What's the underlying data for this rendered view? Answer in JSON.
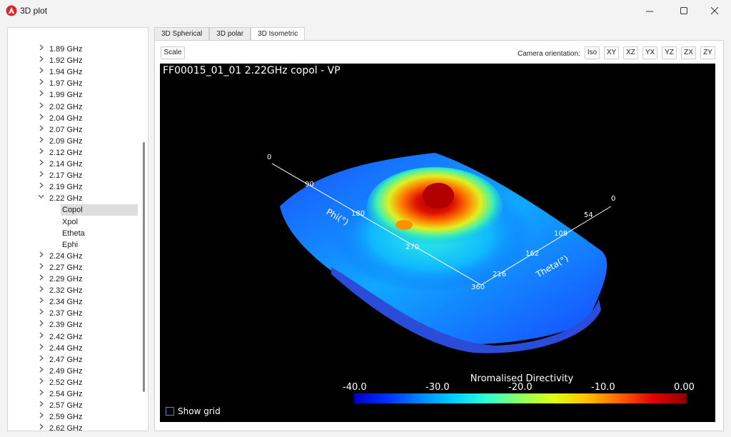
{
  "window": {
    "title": "3D plot"
  },
  "tree": {
    "before": [
      "1.89 GHz",
      "1.92 GHz",
      "1.94 GHz",
      "1.97 GHz",
      "1.99 GHz",
      "2.02 GHz",
      "2.04 GHz",
      "2.07 GHz",
      "2.09 GHz",
      "2.12 GHz",
      "2.14 GHz",
      "2.17 GHz",
      "2.19 GHz"
    ],
    "expanded": "2.22 GHz",
    "children": [
      "Copol",
      "Xpol",
      "Etheta",
      "Ephi"
    ],
    "selected_child": "Copol",
    "after": [
      "2.24 GHz",
      "2.27 GHz",
      "2.29 GHz",
      "2.32 GHz",
      "2.34 GHz",
      "2.37 GHz",
      "2.39 GHz",
      "2.42 GHz",
      "2.44 GHz",
      "2.47 GHz",
      "2.49 GHz",
      "2.52 GHz",
      "2.54 GHz",
      "2.57 GHz",
      "2.59 GHz",
      "2.62 GHz"
    ]
  },
  "tabs": [
    "3D Spherical",
    "3D polar",
    "3D Isometric"
  ],
  "active_tab": "3D Isometric",
  "toolbar": {
    "scale_label": "Scale",
    "camera_label": "Camera orientation:",
    "camera_buttons": [
      "Iso",
      "XY",
      "XZ",
      "YX",
      "YZ",
      "ZX",
      "ZY"
    ]
  },
  "plot": {
    "title": "FF00015_01_01  2.22GHz copol - VP",
    "phi_axis": {
      "label": "Phi(°)",
      "ticks": [
        "0",
        "90",
        "180",
        "270",
        "360"
      ]
    },
    "theta_axis": {
      "label": "Theta(°)",
      "ticks": [
        "0",
        "54",
        "108",
        "162",
        "216"
      ]
    },
    "colorbar": {
      "title": "Nromalised Directivity",
      "ticks": [
        "-40.0",
        "-30.0",
        "-20.0",
        "-10.0",
        "0.00"
      ],
      "range": [
        -40,
        0
      ]
    },
    "show_grid_label": "Show grid",
    "show_grid_checked": false
  },
  "colors": {
    "plot_bg": "#000000",
    "accent": "#e81123"
  },
  "icons": [
    "app-logo-icon",
    "minimize-icon",
    "maximize-icon",
    "close-icon",
    "chevron-right-icon",
    "chevron-down-icon",
    "checkbox-icon"
  ]
}
